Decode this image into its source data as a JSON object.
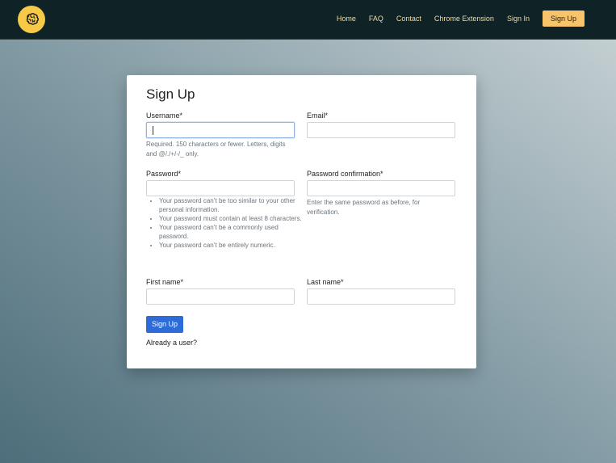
{
  "nav": {
    "links": [
      "Home",
      "FAQ",
      "Contact",
      "Chrome Extension",
      "Sign In"
    ],
    "cta": "Sign Up"
  },
  "form": {
    "title": "Sign Up",
    "username": {
      "label": "Username*",
      "value": "",
      "help": "Required. 150 characters or fewer. Letters, digits and @/./+/-/_ only."
    },
    "email": {
      "label": "Email*",
      "value": ""
    },
    "password": {
      "label": "Password*",
      "value": "",
      "rules": [
        "Your password can’t be too similar to your other personal information.",
        "Your password must contain at least 8 characters.",
        "Your password can’t be a commonly used password.",
        "Your password can’t be entirely numeric."
      ]
    },
    "password_confirmation": {
      "label": "Password confirmation*",
      "value": "",
      "help": "Enter the same password as before, for verification."
    },
    "first_name": {
      "label": "First name*",
      "value": ""
    },
    "last_name": {
      "label": "Last name*",
      "value": ""
    },
    "submit_label": "Sign Up",
    "already_user": "Already a user?"
  },
  "colors": {
    "navbar_bg": "#0f2326",
    "logo_bg": "#f7c948",
    "nav_text": "#f3d9a0",
    "cta_bg": "#f7c46c",
    "button_bg": "#2d6bd7"
  },
  "icons": {
    "logo": "brain-icon"
  }
}
